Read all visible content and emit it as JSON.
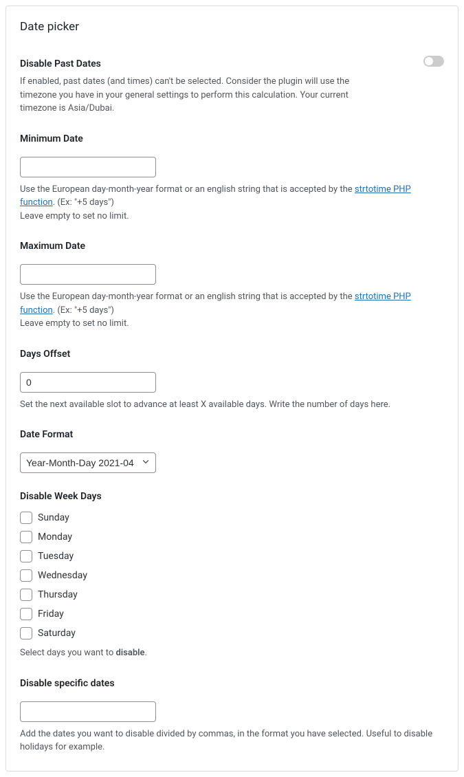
{
  "panel": {
    "title": "Date picker"
  },
  "disablePast": {
    "label": "Disable Past Dates",
    "desc": "If enabled, past dates (and times) can't be selected. Consider the plugin will use the timezone you have in your general settings to perform this calculation. Your current timezone is Asia/Dubai.",
    "toggled": false
  },
  "minDate": {
    "label": "Minimum Date",
    "value": "",
    "desc_pre": "Use the European day-month-year format or an english string that is accepted by the ",
    "link_text": "strtotime PHP function",
    "desc_post": ". (Ex: \"+5 days\")",
    "desc_line2": "Leave empty to set no limit."
  },
  "maxDate": {
    "label": "Maximum Date",
    "value": "",
    "desc_pre": "Use the European day-month-year format or an english string that is accepted by the ",
    "link_text": "strtotime PHP function",
    "desc_post": ". (Ex: \"+5 days\")",
    "desc_line2": "Leave empty to set no limit."
  },
  "daysOffset": {
    "label": "Days Offset",
    "value": "0",
    "desc": "Set the next available slot to advance at least X available days. Write the number of days here."
  },
  "dateFormat": {
    "label": "Date Format",
    "selected": "Year-Month-Day 2021-04"
  },
  "disableWeekDays": {
    "label": "Disable Week Days",
    "days": [
      "Sunday",
      "Monday",
      "Tuesday",
      "Wednesday",
      "Thursday",
      "Friday",
      "Saturday"
    ],
    "desc_pre": "Select days you want to ",
    "desc_strong": "disable",
    "desc_post": "."
  },
  "disableSpecific": {
    "label": "Disable specific dates",
    "value": "",
    "desc": "Add the dates you want to disable divided by commas, in the format you have selected. Useful to disable holidays for example."
  }
}
